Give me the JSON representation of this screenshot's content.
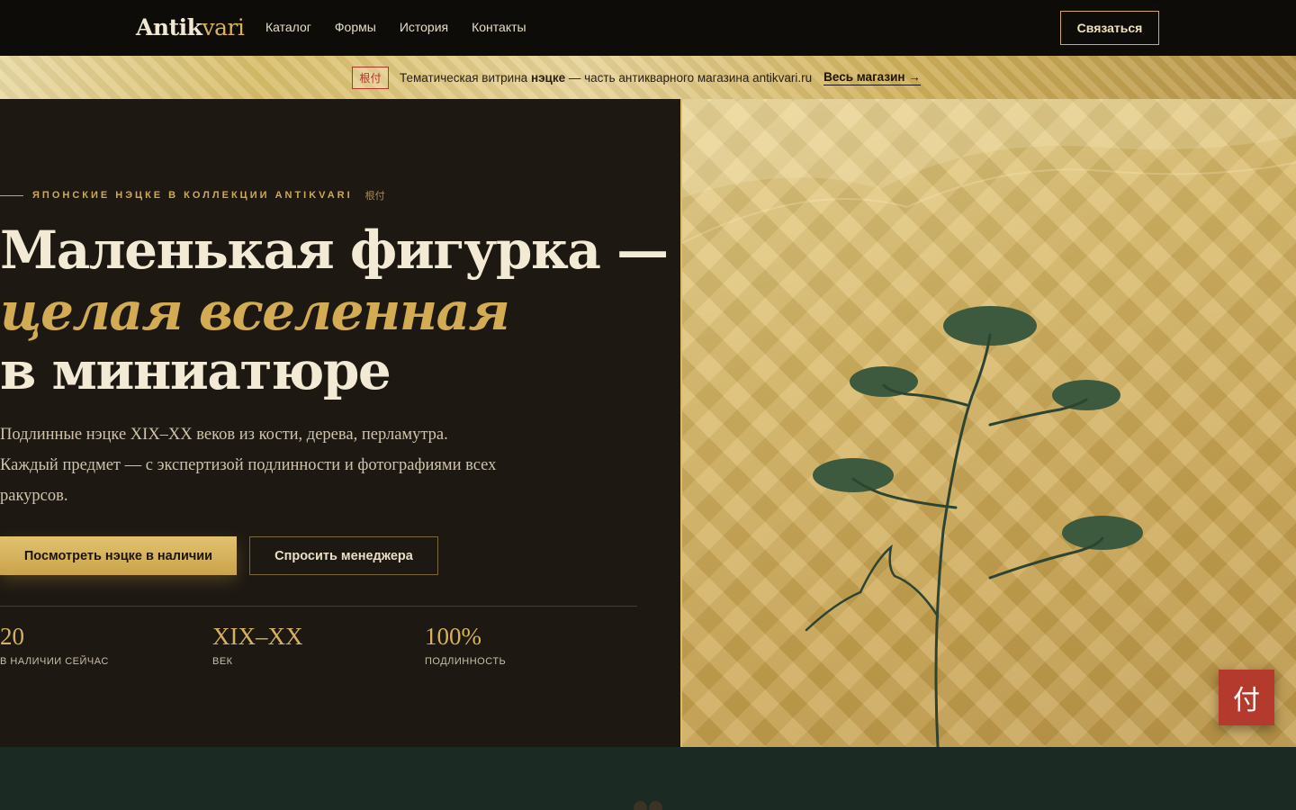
{
  "nav": {
    "logo_main": "Antik",
    "logo_accent": "vari",
    "links": [
      "Каталог",
      "Формы",
      "История",
      "Контакты"
    ],
    "cta": "Связаться"
  },
  "banner": {
    "badge": "根付",
    "text_pre": "Тематическая витрина ",
    "text_bold": "нэцке",
    "text_post": " — часть антикварного магазина antikvari.ru",
    "link": "Весь магазин →"
  },
  "hero": {
    "eyebrow": "ЯПОНСКИЕ НЭЦКЕ В КОЛЛЕКЦИИ ANTIKVARI",
    "eyebrow_kanji": "根付",
    "title_line1": "Маленькая фигурка —",
    "title_line2": "целая вселенная",
    "title_line3": "в миниатюре",
    "lead": "Подлинные нэцке XIX–XX веков из кости, дерева, перламутра. Каждый предмет — с экспертизой подлинности и фотографиями всех ракурсов.",
    "primary_button": "Посмотреть нэцке в наличии",
    "secondary_button": "Спросить менеджера",
    "stats": [
      {
        "value": "20",
        "label": "В НАЛИЧИИ СЕЙЧАС"
      },
      {
        "value": "XIX–XX",
        "label": "ВЕК"
      },
      {
        "value": "100%",
        "label": "ПОДЛИННОСТЬ"
      }
    ]
  },
  "fab": {
    "label": "付"
  },
  "colors": {
    "accent_gold": "#d2ab52",
    "dark_bg": "#1d1812",
    "leaf_green": "#3d5a3e",
    "seal_red": "#b33a2c"
  }
}
